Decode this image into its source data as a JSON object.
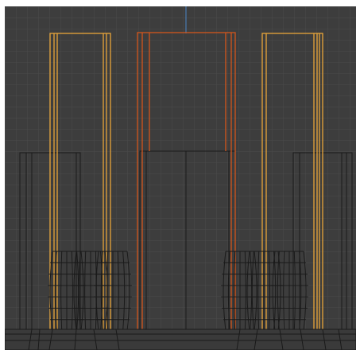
{
  "viewport": {
    "background": "#3d3d3d",
    "grid_color": "#4a4a4a",
    "axis_color": "#4b86c8",
    "view": "front-orthographic",
    "shading": "wireframe"
  },
  "objects": [
    {
      "name": "left-box-back",
      "kind": "box",
      "wire_color": "#1a1a1a"
    },
    {
      "name": "right-box-back",
      "kind": "box",
      "wire_color": "#1a1a1a"
    },
    {
      "name": "center-box-back",
      "kind": "box",
      "wire_color": "#1a1a1a"
    },
    {
      "name": "left-tall-box",
      "kind": "box",
      "wire_color": "#e8a53a",
      "selected": true
    },
    {
      "name": "center-tall-box",
      "kind": "box",
      "wire_color": "#d2561c",
      "active": true
    },
    {
      "name": "right-tall-box",
      "kind": "box",
      "wire_color": "#e8a53a",
      "selected": true
    },
    {
      "name": "left-barrel-group",
      "kind": "barrels",
      "count": 3,
      "wire_color": "#1a1a1a"
    },
    {
      "name": "right-barrel-group",
      "kind": "barrels",
      "count": 3,
      "wire_color": "#1a1a1a"
    },
    {
      "name": "ground-base",
      "kind": "plane",
      "wire_color": "#1a1a1a"
    }
  ],
  "icons": {
    "grid": "viewport-grid",
    "axis": "z-axis-line"
  }
}
